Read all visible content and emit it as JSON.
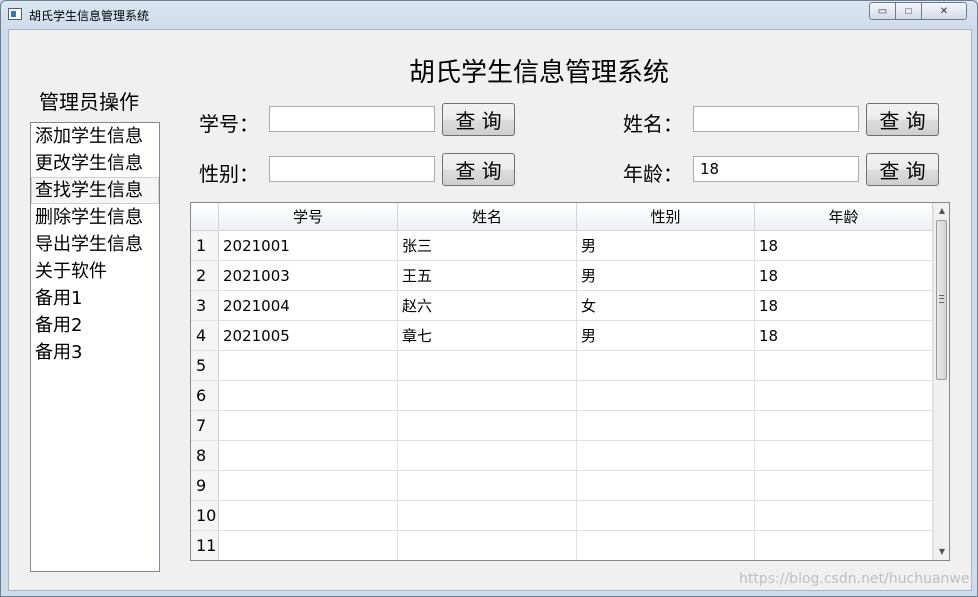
{
  "window": {
    "title": "胡氏学生信息管理系统",
    "controls": {
      "minimize": "▭",
      "maximize": "□",
      "close": "✕"
    }
  },
  "main": {
    "title": "胡氏学生信息管理系统"
  },
  "sidebar": {
    "title": "管理员操作",
    "items": [
      {
        "label": "添加学生信息"
      },
      {
        "label": "更改学生信息"
      },
      {
        "label": "查找学生信息",
        "selected": true
      },
      {
        "label": "删除学生信息"
      },
      {
        "label": "导出学生信息"
      },
      {
        "label": "关于软件"
      },
      {
        "label": "备用1"
      },
      {
        "label": "备用2"
      },
      {
        "label": "备用3"
      }
    ]
  },
  "search": {
    "id": {
      "label": "学号：",
      "value": "",
      "button": "查 询"
    },
    "name": {
      "label": "姓名：",
      "value": "",
      "button": "查 询"
    },
    "gender": {
      "label": "性别：",
      "value": "",
      "button": "查 询"
    },
    "age": {
      "label": "年龄：",
      "value": "18",
      "button": "查 询"
    }
  },
  "table": {
    "columns": [
      "学号",
      "姓名",
      "性别",
      "年龄"
    ],
    "row_numbers": [
      "1",
      "2",
      "3",
      "4",
      "5",
      "6",
      "7",
      "8",
      "9",
      "10",
      "11"
    ],
    "rows": [
      [
        "2021001",
        "张三",
        "男",
        "18"
      ],
      [
        "2021003",
        "王五",
        "男",
        "18"
      ],
      [
        "2021004",
        "赵六",
        "女",
        "18"
      ],
      [
        "2021005",
        "章七",
        "男",
        "18"
      ],
      [
        "",
        "",
        "",
        ""
      ],
      [
        "",
        "",
        "",
        ""
      ],
      [
        "",
        "",
        "",
        ""
      ],
      [
        "",
        "",
        "",
        ""
      ],
      [
        "",
        "",
        "",
        ""
      ],
      [
        "",
        "",
        "",
        ""
      ],
      [
        "",
        "",
        "",
        ""
      ]
    ]
  },
  "scrollbar": {
    "up": "▲",
    "down": "▼"
  },
  "watermark": "https://blog.csdn.net/huchuanwei"
}
